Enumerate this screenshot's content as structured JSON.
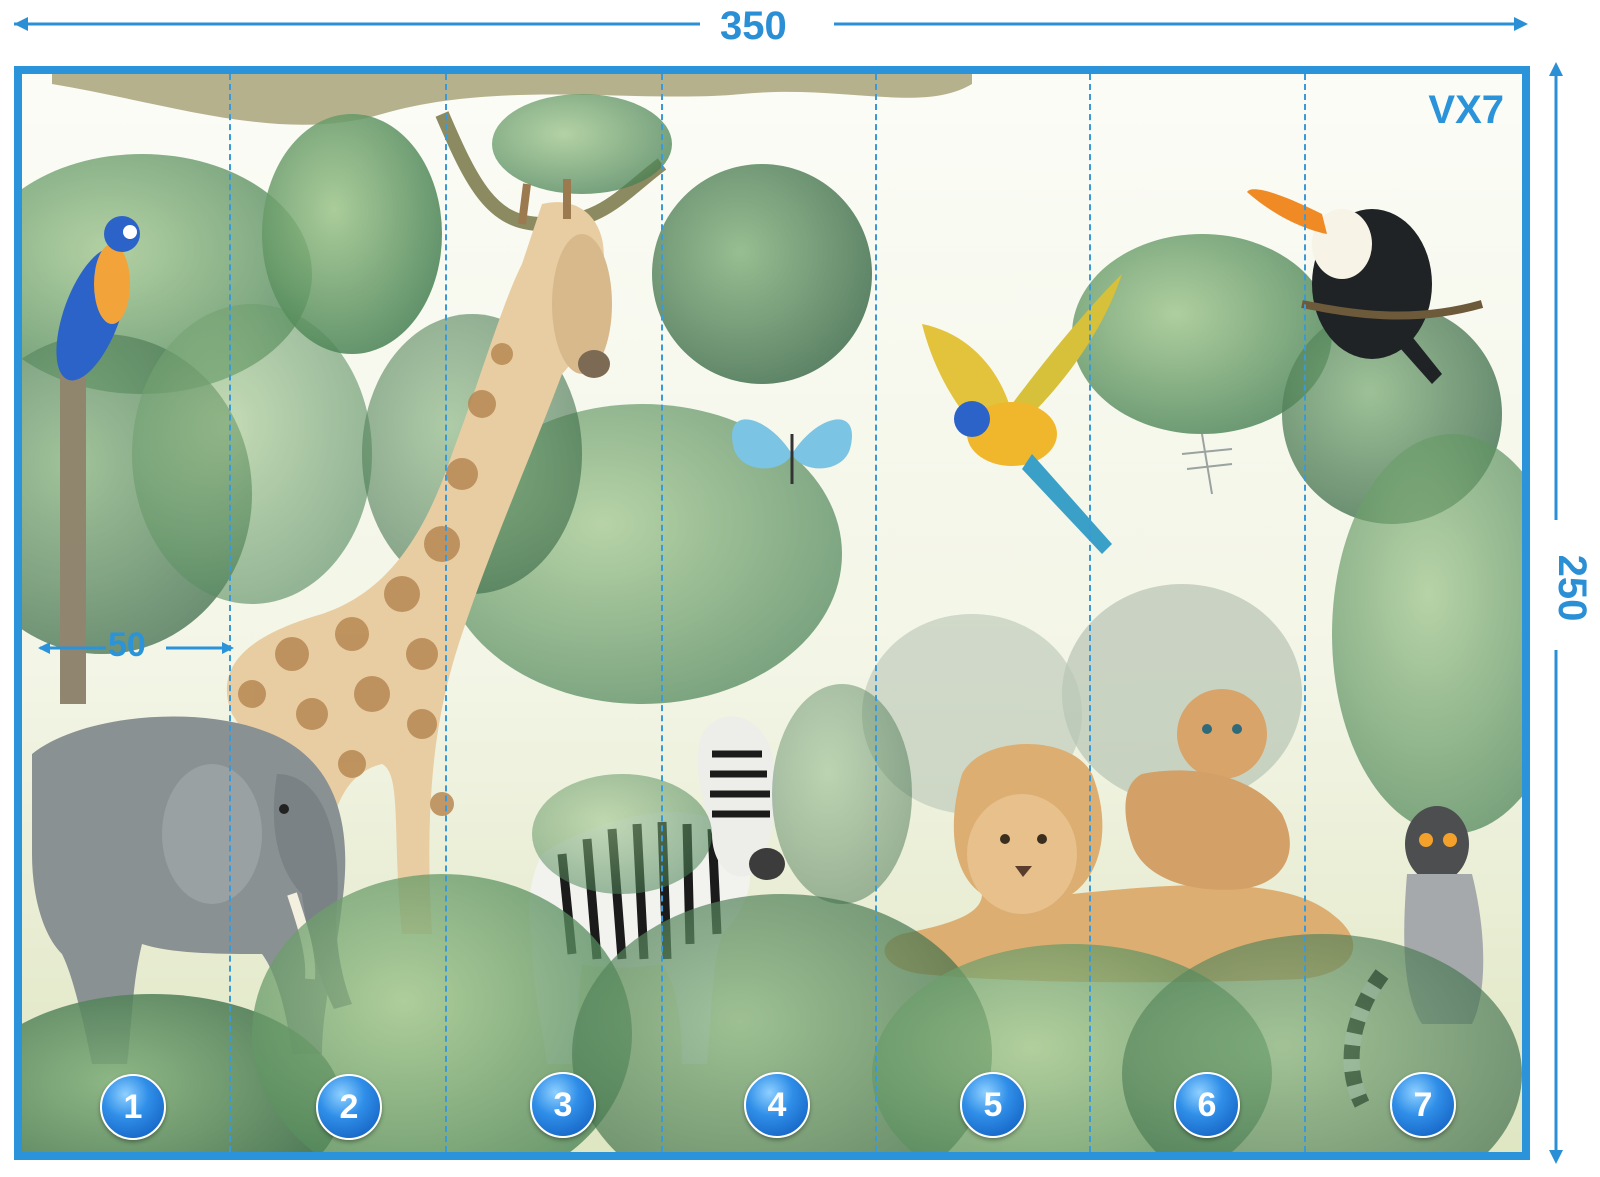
{
  "dimensions": {
    "width_label": "350",
    "height_label": "250",
    "panel_width_label": "50"
  },
  "code_label": "VX7",
  "panels": [
    "1",
    "2",
    "3",
    "4",
    "5",
    "6",
    "7"
  ],
  "colors": {
    "frame": "#2a93da",
    "badge": "#2f8ee8"
  },
  "scene_content": [
    "parrot",
    "giraffe",
    "butterfly",
    "parrot-flying",
    "toucan",
    "elephant",
    "zebra",
    "lioness",
    "lion-cub",
    "lemur",
    "dragonfly"
  ]
}
